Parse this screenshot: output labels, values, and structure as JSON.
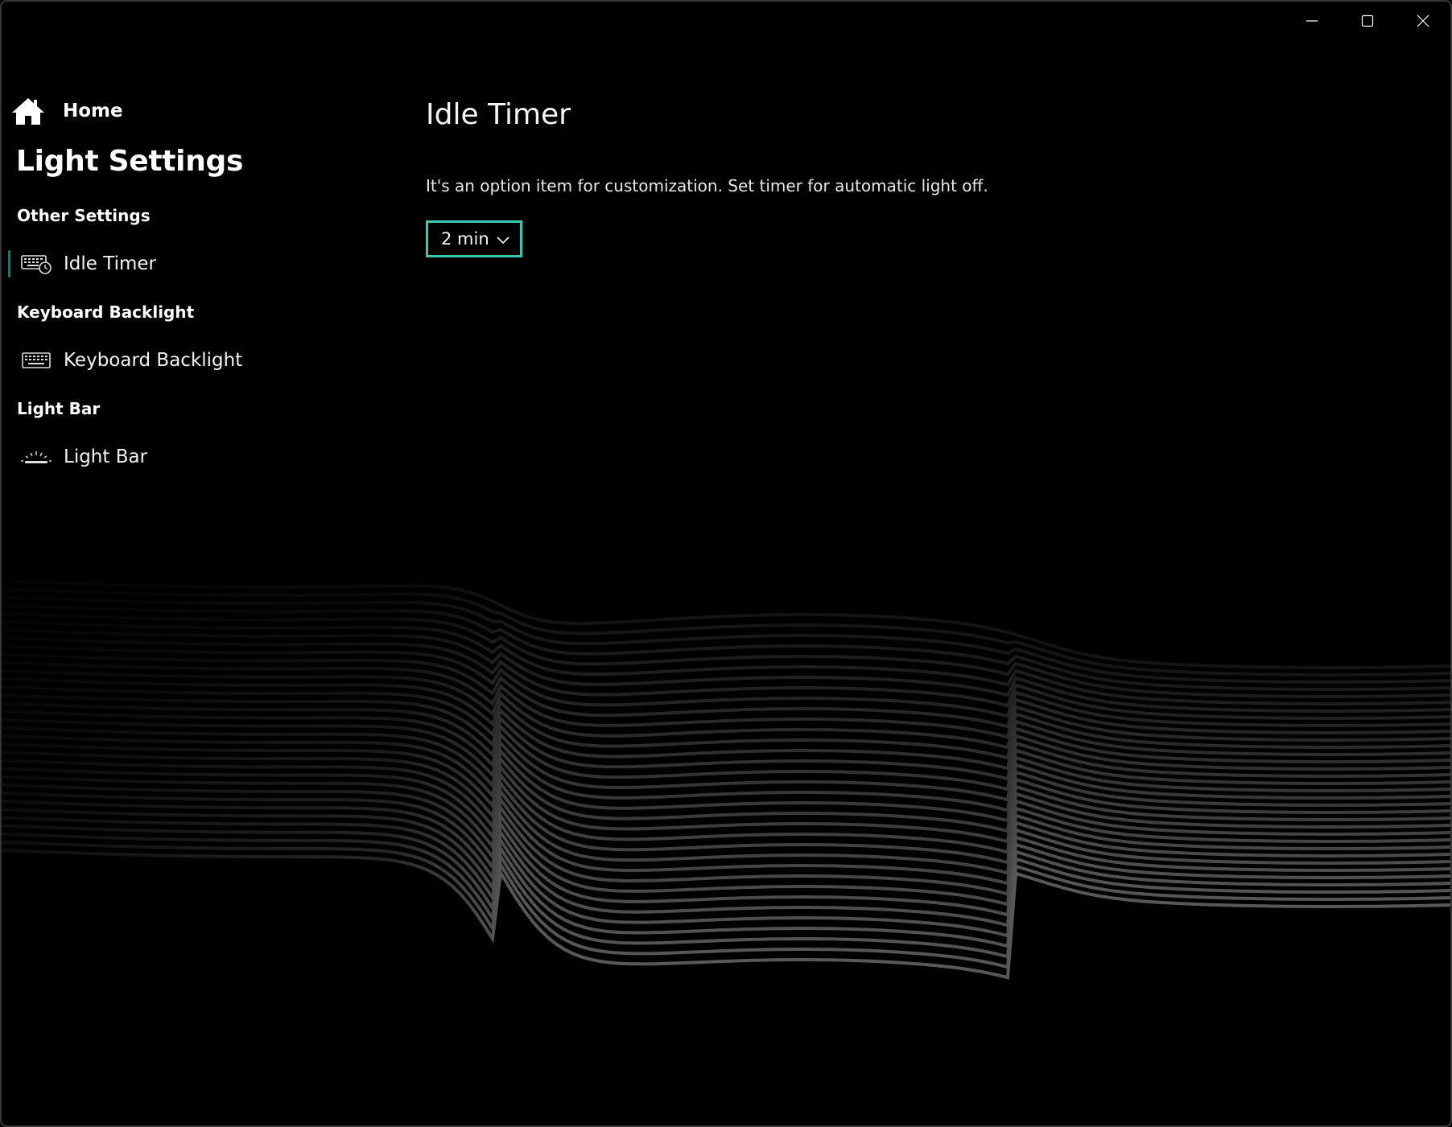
{
  "window": {
    "controls": [
      "minimize-icon",
      "maximize-icon",
      "close-icon"
    ]
  },
  "sidebar": {
    "home_label": "Home",
    "title": "Light Settings",
    "sections": [
      {
        "heading": "Other Settings",
        "item": {
          "label": "Idle Timer",
          "icon": "keyboard-timer-icon",
          "selected": true
        }
      },
      {
        "heading": "Keyboard Backlight",
        "item": {
          "label": "Keyboard Backlight",
          "icon": "keyboard-icon",
          "selected": false
        }
      },
      {
        "heading": "Light Bar",
        "item": {
          "label": "Light Bar",
          "icon": "light-bar-icon",
          "selected": false
        }
      }
    ]
  },
  "main": {
    "title": "Idle Timer",
    "description": "It's an option item for customization. Set timer for automatic light off.",
    "timer_dropdown": {
      "value": "2 min"
    }
  },
  "colors": {
    "background": "#000000",
    "accent": "#3fc7b4",
    "selection_indicator": "#2a6b63"
  }
}
